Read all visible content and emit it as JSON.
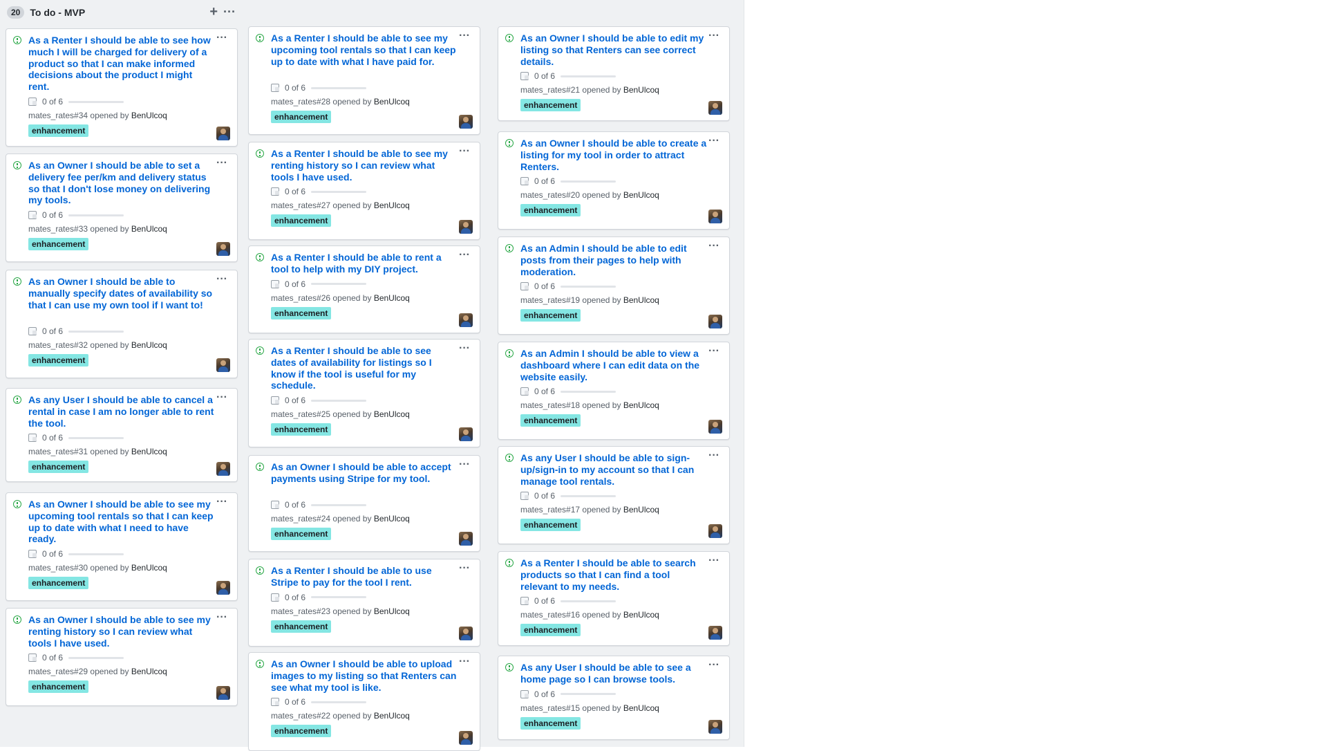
{
  "column": {
    "count": "20",
    "title": "To do - MVP",
    "add_icon": "plus-icon",
    "menu_icon": "ellipsis-icon"
  },
  "label_color": "#84e6e3",
  "cards": [
    {
      "title": "As a Renter I should be able to see how much I will be charged for delivery of a product so that I can make informed decisions about the product I might rent.",
      "progress": "0 of 6",
      "progress_fraction": 0,
      "ref": "mates_rates#34",
      "opened_by": "opened by",
      "author": "BenUlcoq",
      "label": "enhancement"
    },
    {
      "title": "As an Owner I should be able to set a delivery fee per/km and delivery status so that I don't lose money on delivering my tools.",
      "progress": "0 of 6",
      "progress_fraction": 0,
      "ref": "mates_rates#33",
      "opened_by": "opened by",
      "author": "BenUlcoq",
      "label": "enhancement"
    },
    {
      "title": "As an Owner I should be able to manually specify dates of availability so that I can use my own tool if I want to!",
      "progress": "0 of 6",
      "progress_fraction": 0,
      "ref": "mates_rates#32",
      "opened_by": "opened by",
      "author": "BenUlcoq",
      "label": "enhancement"
    },
    {
      "title": "As any User I should be able to cancel a rental in case I am no longer able to rent the tool.",
      "progress": "0 of 6",
      "progress_fraction": 0,
      "ref": "mates_rates#31",
      "opened_by": "opened by",
      "author": "BenUlcoq",
      "label": "enhancement"
    },
    {
      "title": "As an Owner I should be able to see my upcoming tool rentals so that I can keep up to date with what I need to have ready.",
      "progress": "0 of 6",
      "progress_fraction": 0,
      "ref": "mates_rates#30",
      "opened_by": "opened by",
      "author": "BenUlcoq",
      "label": "enhancement"
    },
    {
      "title": "As an Owner I should be able to see my renting history so I can review what tools I have used.",
      "progress": "0 of 6",
      "progress_fraction": 0,
      "ref": "mates_rates#29",
      "opened_by": "opened by",
      "author": "BenUlcoq",
      "label": "enhancement"
    },
    {
      "title": "As a Renter I should be able to see my upcoming tool rentals so that I can keep up to date with what I have paid for.",
      "progress": "0 of 6",
      "progress_fraction": 0,
      "ref": "mates_rates#28",
      "opened_by": "opened by",
      "author": "BenUlcoq",
      "label": "enhancement"
    },
    {
      "title": "As a Renter I should be able to see my renting history so I can review what tools I have used.",
      "progress": "0 of 6",
      "progress_fraction": 0,
      "ref": "mates_rates#27",
      "opened_by": "opened by",
      "author": "BenUlcoq",
      "label": "enhancement"
    },
    {
      "title": "As a Renter I should be able to rent a tool to help with my DIY project.",
      "progress": "0 of 6",
      "progress_fraction": 0,
      "ref": "mates_rates#26",
      "opened_by": "opened by",
      "author": "BenUlcoq",
      "label": "enhancement"
    },
    {
      "title": "As a Renter I should be able to see dates of availability for listings so I know if the tool is useful for my schedule.",
      "progress": "0 of 6",
      "progress_fraction": 0,
      "ref": "mates_rates#25",
      "opened_by": "opened by",
      "author": "BenUlcoq",
      "label": "enhancement"
    },
    {
      "title": "As an Owner I should be able to accept payments using Stripe for my tool.",
      "progress": "0 of 6",
      "progress_fraction": 0,
      "ref": "mates_rates#24",
      "opened_by": "opened by",
      "author": "BenUlcoq",
      "label": "enhancement"
    },
    {
      "title": "As a Renter I should be able to use Stripe to pay for the tool I rent.",
      "progress": "0 of 6",
      "progress_fraction": 0,
      "ref": "mates_rates#23",
      "opened_by": "opened by",
      "author": "BenUlcoq",
      "label": "enhancement"
    },
    {
      "title": "As an Owner I should be able to upload images to my listing so that Renters can see what my tool is like.",
      "progress": "0 of 6",
      "progress_fraction": 0,
      "ref": "mates_rates#22",
      "opened_by": "opened by",
      "author": "BenUlcoq",
      "label": "enhancement"
    },
    {
      "title": "As an Owner I should be able to edit my listing so that Renters can see correct details.",
      "progress": "0 of 6",
      "progress_fraction": 0,
      "ref": "mates_rates#21",
      "opened_by": "opened by",
      "author": "BenUlcoq",
      "label": "enhancement"
    },
    {
      "title": "As an Owner I should be able to create a listing for my tool in order to attract Renters.",
      "progress": "0 of 6",
      "progress_fraction": 0,
      "ref": "mates_rates#20",
      "opened_by": "opened by",
      "author": "BenUlcoq",
      "label": "enhancement"
    },
    {
      "title": "As an Admin I should be able to edit posts from their pages to help with moderation.",
      "progress": "0 of 6",
      "progress_fraction": 0,
      "ref": "mates_rates#19",
      "opened_by": "opened by",
      "author": "BenUlcoq",
      "label": "enhancement"
    },
    {
      "title": "As an Admin I should be able to view a dashboard where I can edit data on the website easily.",
      "progress": "0 of 6",
      "progress_fraction": 0,
      "ref": "mates_rates#18",
      "opened_by": "opened by",
      "author": "BenUlcoq",
      "label": "enhancement"
    },
    {
      "title": "As any User I should be able to sign-up/sign-in to my account so that I can manage tool rentals.",
      "progress": "0 of 6",
      "progress_fraction": 0,
      "ref": "mates_rates#17",
      "opened_by": "opened by",
      "author": "BenUlcoq",
      "label": "enhancement"
    },
    {
      "title": "As a Renter I should be able to search products so that I can find a tool relevant to my needs.",
      "progress": "0 of 6",
      "progress_fraction": 0,
      "ref": "mates_rates#16",
      "opened_by": "opened by",
      "author": "BenUlcoq",
      "label": "enhancement"
    },
    {
      "title": "As any User I should be able to see a home page so I can browse tools.",
      "progress": "0 of 6",
      "progress_fraction": 0,
      "ref": "mates_rates#15",
      "opened_by": "opened by",
      "author": "BenUlcoq",
      "label": "enhancement"
    }
  ]
}
